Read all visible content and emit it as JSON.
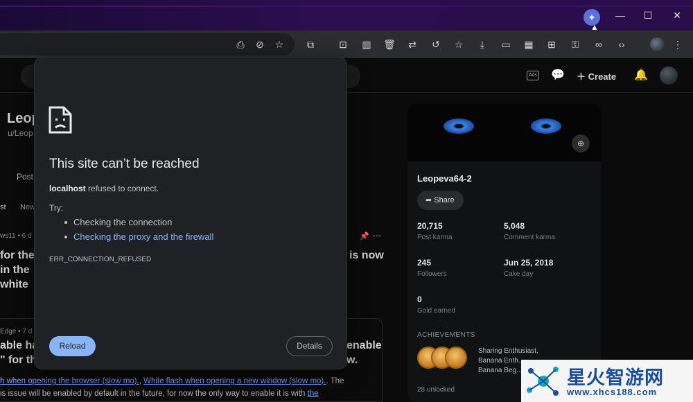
{
  "toolbar": {
    "icons": [
      "install-app-icon",
      "hide-icon",
      "bookmark-star-icon",
      "extensions-icon",
      "screenshot-icon",
      "reading-mode-icon",
      "delete-icon",
      "translate-icon",
      "history-icon",
      "favorites-icon",
      "download-icon",
      "devices-icon",
      "qr-icon",
      "read-aloud-icon",
      "password-icon",
      "link-icon",
      "devtools-icon",
      "more-icon"
    ]
  },
  "reddit": {
    "create_label": "Create",
    "ads_label": "Ads",
    "profile_name_partial": "Leop",
    "profile_handle_partial": "u/Leop",
    "tab_posts_partial": "Post",
    "sort_hot_partial": "st",
    "sort_new_partial": "New",
    "post_meta_partial": "ws11 • 6 d",
    "post_title_lines": [
      "for the",
      "in the",
      "white"
    ],
    "post_title_right": "is now",
    "feed_meta_partial": "Edge • 7 d",
    "feed_title_line1_left": "able ha",
    "feed_title_line1_right": "enable",
    "feed_title_line2_left": "\" for th",
    "feed_title_line2_right": "w.",
    "feed_link1": "h when opening the browser (slow mo).",
    "feed_sep": ", ",
    "feed_link2": "White flash when opening a new window (slow mo).",
    "feed_after": ". The",
    "feed_line2": "is issue will be enabled by default in the future, for now the only way to enable it is with",
    "feed_link3": "the"
  },
  "profile_card": {
    "name": "Leopeva64-2",
    "share_label": "Share",
    "post_karma_value": "20,715",
    "post_karma_label": "Post karma",
    "comment_karma_value": "5,048",
    "comment_karma_label": "Comment karma",
    "followers_value": "245",
    "followers_label": "Followers",
    "cake_day_value": "Jun 25, 2018",
    "cake_day_label": "Cake day",
    "gold_value": "0",
    "gold_label": "Gold earned",
    "achievements_heading": "ACHIEVEMENTS",
    "achievements": [
      "Sharing Enthusiast,",
      "Banana Enth...",
      "Banana Beg..."
    ],
    "unlocked": "28 unlocked"
  },
  "error": {
    "title": "This site can’t be reached",
    "host": "localhost",
    "message": " refused to connect.",
    "try_label": "Try:",
    "suggestions": [
      "Checking the connection",
      "Checking the proxy and the firewall"
    ],
    "code": "ERR_CONNECTION_REFUSED",
    "reload_label": "Reload",
    "details_label": "Details"
  },
  "watermark": {
    "title": "星火智游网",
    "url": "www.xhcs188.com"
  },
  "colors": {
    "link_blue": "#8ab4f8",
    "dialog_bg": "#202124",
    "titlebar_purple": "#2a0e4e"
  }
}
